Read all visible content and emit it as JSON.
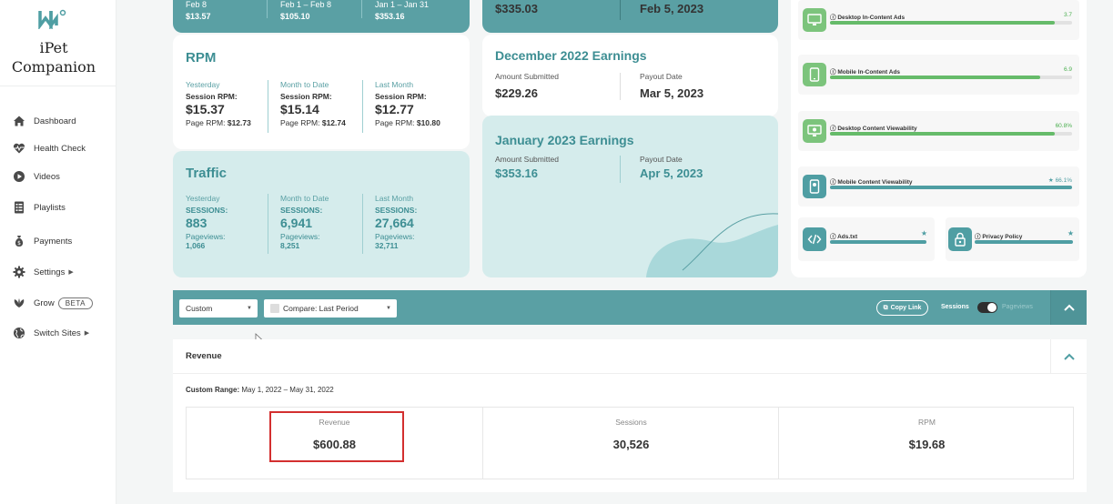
{
  "app": {
    "brand": "iPet\nCompanion"
  },
  "sidebar": {
    "items": [
      {
        "label": "Dashboard",
        "icon": "home-icon"
      },
      {
        "label": "Health Check",
        "icon": "heartbeat-icon"
      },
      {
        "label": "Videos",
        "icon": "play-icon"
      },
      {
        "label": "Playlists",
        "icon": "list-icon"
      },
      {
        "label": "Payments",
        "icon": "money-bag-icon"
      },
      {
        "label": "Settings",
        "icon": "gear-icon"
      },
      {
        "label": "Grow",
        "icon": "leaf-icon",
        "badge": "BETA"
      },
      {
        "label": "Switch Sites",
        "icon": "globe-icon"
      }
    ]
  },
  "top_strip": [
    {
      "range": "Feb 8",
      "value": "$13.57"
    },
    {
      "range": "Feb 1 – Feb 8",
      "value": "$105.10"
    },
    {
      "range": "Jan 1 – Jan 31",
      "value": "$353.16"
    }
  ],
  "top_earnings_strip": {
    "amount": "$335.03",
    "date": "Feb 5, 2023"
  },
  "rpm": {
    "title": "RPM",
    "cols": [
      {
        "period": "Yesterday",
        "metric": "Session RPM:",
        "value": "$15.37",
        "sub_label": "Page RPM:",
        "sub_value": "$12.73"
      },
      {
        "period": "Month to Date",
        "metric": "Session RPM:",
        "value": "$15.14",
        "sub_label": "Page RPM:",
        "sub_value": "$12.74"
      },
      {
        "period": "Last Month",
        "metric": "Session RPM:",
        "value": "$12.77",
        "sub_label": "Page RPM:",
        "sub_value": "$10.80"
      }
    ]
  },
  "traffic": {
    "title": "Traffic",
    "cols": [
      {
        "period": "Yesterday",
        "metric": "SESSIONS:",
        "value": "883",
        "sub_label": "Pageviews:",
        "sub_value": "1,066"
      },
      {
        "period": "Month to Date",
        "metric": "SESSIONS:",
        "value": "6,941",
        "sub_label": "Pageviews:",
        "sub_value": "8,251"
      },
      {
        "period": "Last Month",
        "metric": "SESSIONS:",
        "value": "27,664",
        "sub_label": "Pageviews:",
        "sub_value": "32,711"
      }
    ]
  },
  "earnings": [
    {
      "title": "December 2022 Earnings",
      "amount_label": "Amount Submitted",
      "amount": "$229.26",
      "date_label": "Payout Date",
      "date": "Mar 5, 2023"
    },
    {
      "title": "January 2023 Earnings",
      "amount_label": "Amount Submitted",
      "amount": "$353.16",
      "date_label": "Payout Date",
      "date": "Apr 5, 2023"
    }
  ],
  "health": [
    {
      "name": "Desktop In-Content Ads",
      "value": "3.7",
      "fill": 0.93,
      "icon": "desktop-icon"
    },
    {
      "name": "Mobile In-Content Ads",
      "value": "6.9",
      "fill": 0.87,
      "icon": "mobile-icon"
    },
    {
      "name": "Desktop Content Viewability",
      "value": "60.8%",
      "fill": 0.93,
      "icon": "desktop-eye-icon"
    },
    {
      "name": "Mobile Content Viewability",
      "value": "66.1%",
      "fill": 1.0,
      "icon": "mobile-eye-icon"
    }
  ],
  "health_small": [
    {
      "name": "Ads.txt",
      "icon": "code-icon"
    },
    {
      "name": "Privacy Policy",
      "icon": "lock-icon"
    }
  ],
  "filters": {
    "range_select": "Custom",
    "compare_select": "Compare: Last Period",
    "copy_link": "Copy Link",
    "toggle_left": "Sessions",
    "toggle_right": "Pageviews"
  },
  "revenue": {
    "title": "Revenue",
    "range_label": "Custom Range:",
    "range_value": "May 1, 2022 – May 31, 2022",
    "stats": [
      {
        "label": "Revenue",
        "value": "$600.88"
      },
      {
        "label": "Sessions",
        "value": "30,526"
      },
      {
        "label": "RPM",
        "value": "$19.68"
      }
    ]
  },
  "colors": {
    "accent": "#5aa0a4",
    "light": "#d5ecec",
    "good": "#66bb6a",
    "highlight": "#d32f2f"
  }
}
